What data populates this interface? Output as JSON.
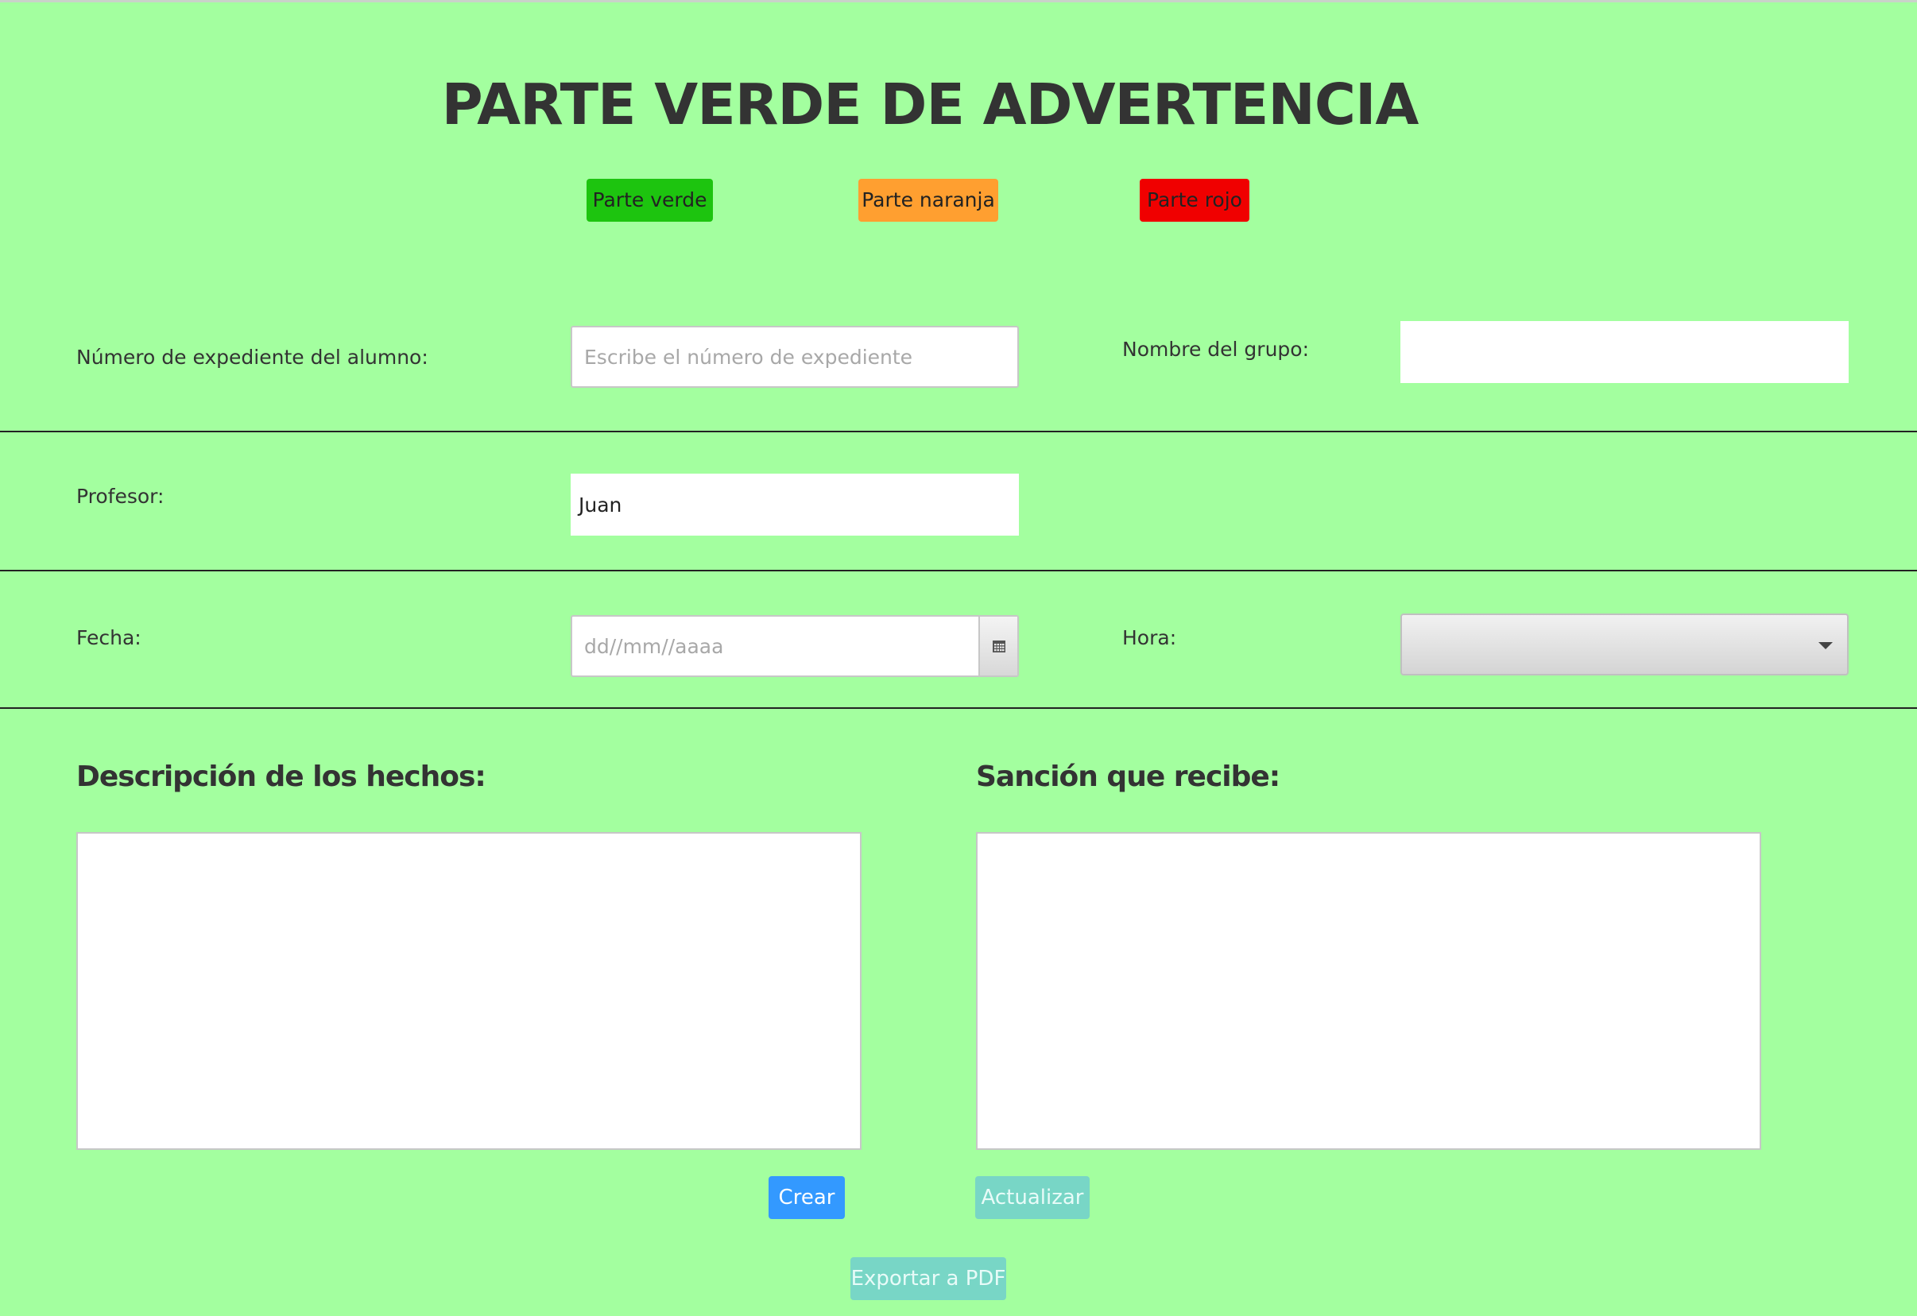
{
  "title": "PARTE VERDE DE ADVERTENCIA",
  "tabs": {
    "verde": "Parte verde",
    "naranja": "Parte naranja",
    "rojo": "Parte rojo"
  },
  "form": {
    "expediente_label": "Número de expediente del alumno:",
    "expediente_placeholder": "Escribe el número de expediente",
    "grupo_label": "Nombre del grupo:",
    "grupo_value": "",
    "profesor_label": "Profesor:",
    "profesor_value": "Juan",
    "fecha_label": "Fecha:",
    "fecha_placeholder": "dd//mm//aaaa",
    "hora_label": "Hora:",
    "hora_value": ""
  },
  "descripcion_title": "Descripción de los hechos:",
  "sancion_title": "Sanción que recibe:",
  "buttons": {
    "crear": "Crear",
    "actualizar": "Actualizar",
    "exportar": "Exportar a PDF"
  },
  "colors": {
    "background": "#a3ff9f",
    "verde": "#1dc40f",
    "naranja": "#ff9f30",
    "rojo": "#f00000",
    "crear": "#3399ff",
    "disabled": "#78d6c6"
  }
}
